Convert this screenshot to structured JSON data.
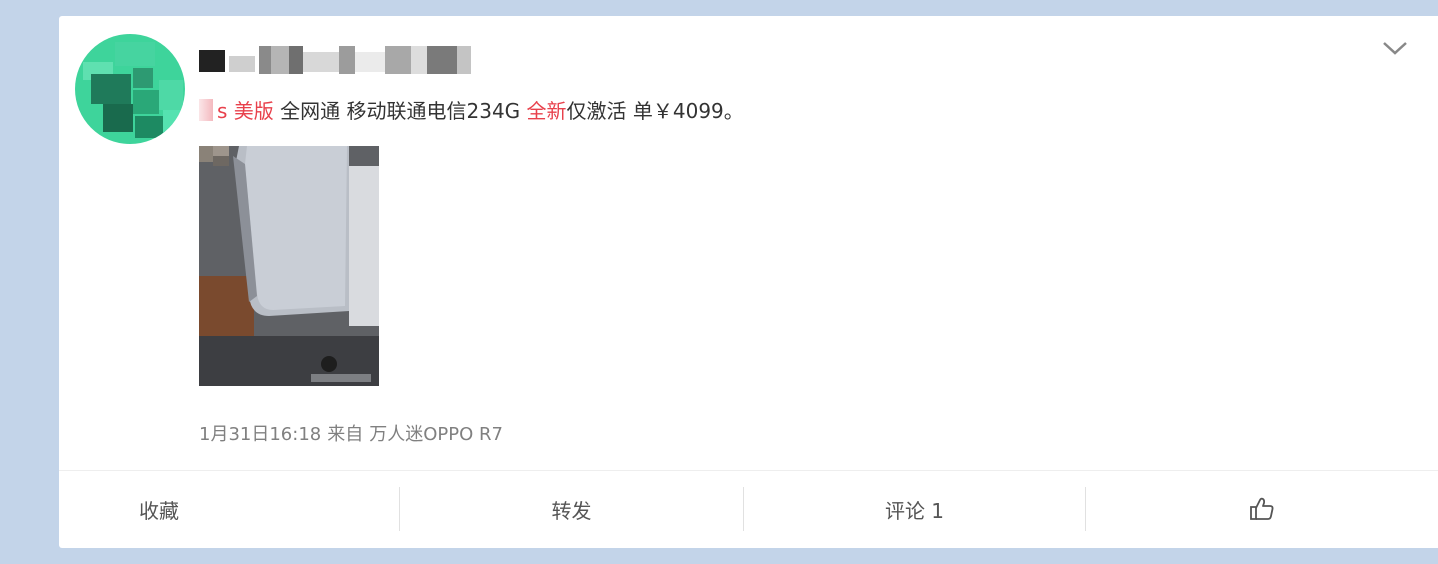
{
  "post": {
    "username": "",
    "text_prefix_red": "s 美版",
    "text_mid": " 全网通 移动联通电信234G ",
    "text_red_2": "全新",
    "text_end": "仅激活 单￥4099。",
    "time": "1月31日16:18",
    "source_prefix": "来自",
    "source": "万人迷OPPO R7"
  },
  "actions": {
    "favorite": "收藏",
    "repost": "转发",
    "comment": "评论 1"
  },
  "icons": {
    "menu": "chevron-down-icon",
    "like": "thumbs-up-icon"
  },
  "colors": {
    "page_bg": "#c3d4e9",
    "card_bg": "#ffffff",
    "accent_red": "#e8414c",
    "text": "#333333",
    "meta": "#808080"
  }
}
